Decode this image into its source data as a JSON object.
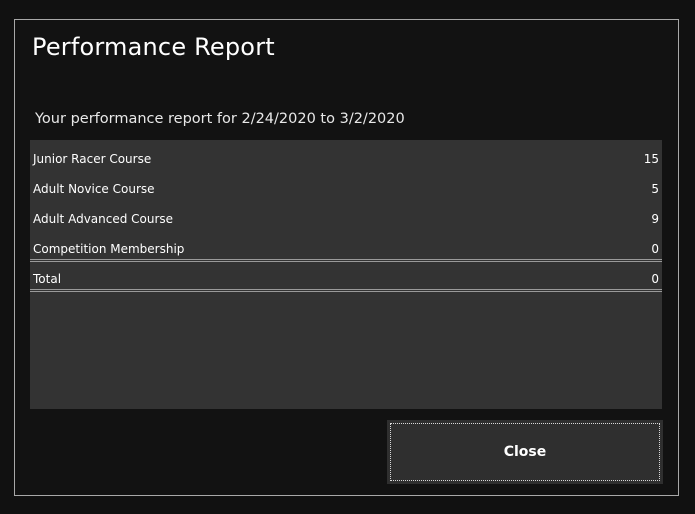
{
  "dialog": {
    "title": "Performance Report",
    "subtitle": "Your performance report for 2/24/2020 to 3/2/2020"
  },
  "report": {
    "rows": [
      {
        "label": "Junior Racer Course",
        "value": "15"
      },
      {
        "label": "Adult Novice Course",
        "value": "5"
      },
      {
        "label": "Adult Advanced Course",
        "value": "9"
      },
      {
        "label": "Competition Membership",
        "value": "0"
      }
    ],
    "total": {
      "label": "Total",
      "value": "0"
    }
  },
  "buttons": {
    "close_label": "Close"
  },
  "colors": {
    "background": "#111111",
    "panel": "#333333",
    "border": "#a8a8a8",
    "text": "#ffffff"
  }
}
